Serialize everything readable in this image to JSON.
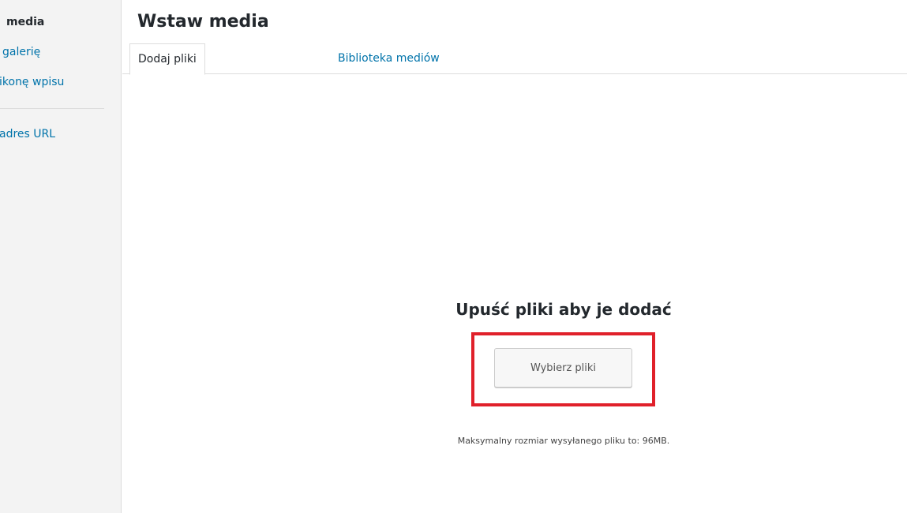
{
  "menu": {
    "items": [
      {
        "label": "media"
      },
      {
        "label": "galerię"
      },
      {
        "label": "ikonę wpisu"
      },
      {
        "label": "adres URL"
      }
    ]
  },
  "frame": {
    "title": "Wstaw media"
  },
  "tabs": [
    {
      "label": "Dodaj pliki"
    },
    {
      "label": "Biblioteka mediów"
    }
  ],
  "uploader": {
    "drop_instructions": "Upuść pliki aby je dodać",
    "select_button": "Wybierz pliki",
    "max_size_text": "Maksymalny rozmiar wysyłanego pliku to: 96MB.",
    "highlight_color": "#e0202a"
  },
  "colors": {
    "link": "#0073aa",
    "text": "#23282d",
    "menu_bg": "#f3f3f3"
  }
}
